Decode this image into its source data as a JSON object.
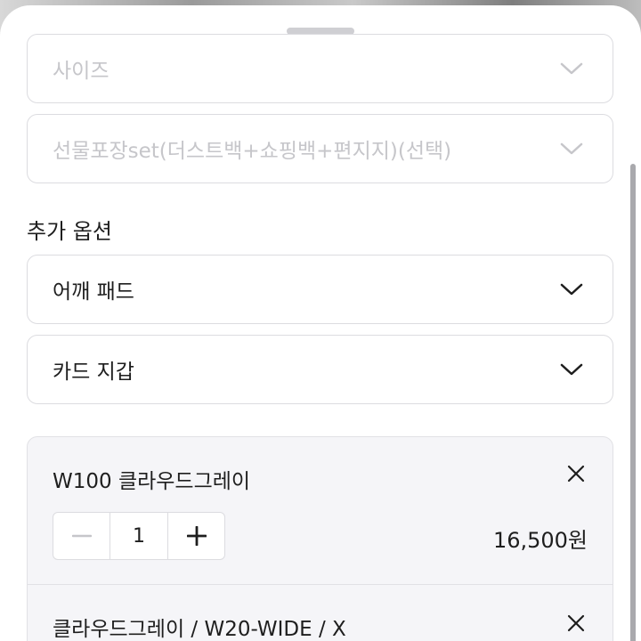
{
  "selects_disabled": [
    {
      "label": "사이즈"
    },
    {
      "label": "선물포장set(더스트백+쇼핑백+편지지)(선택)"
    }
  ],
  "additional_options": {
    "title": "추가 옵션",
    "selects": [
      {
        "label": "어깨 패드"
      },
      {
        "label": "카드 지갑"
      }
    ]
  },
  "selected_options": [
    {
      "name": "W100 클라우드그레이",
      "quantity": "1",
      "price": "16,500원"
    },
    {
      "name": "클라우드그레이 / W20-WIDE / X"
    }
  ],
  "colors": {
    "text": "#1e1e1e",
    "disabled_text": "#c6c6ca",
    "border": "#dcdce0",
    "card_bg": "#f5f5f8"
  },
  "icons": [
    "chevron-down-icon",
    "close-icon",
    "minus-icon",
    "plus-icon"
  ]
}
